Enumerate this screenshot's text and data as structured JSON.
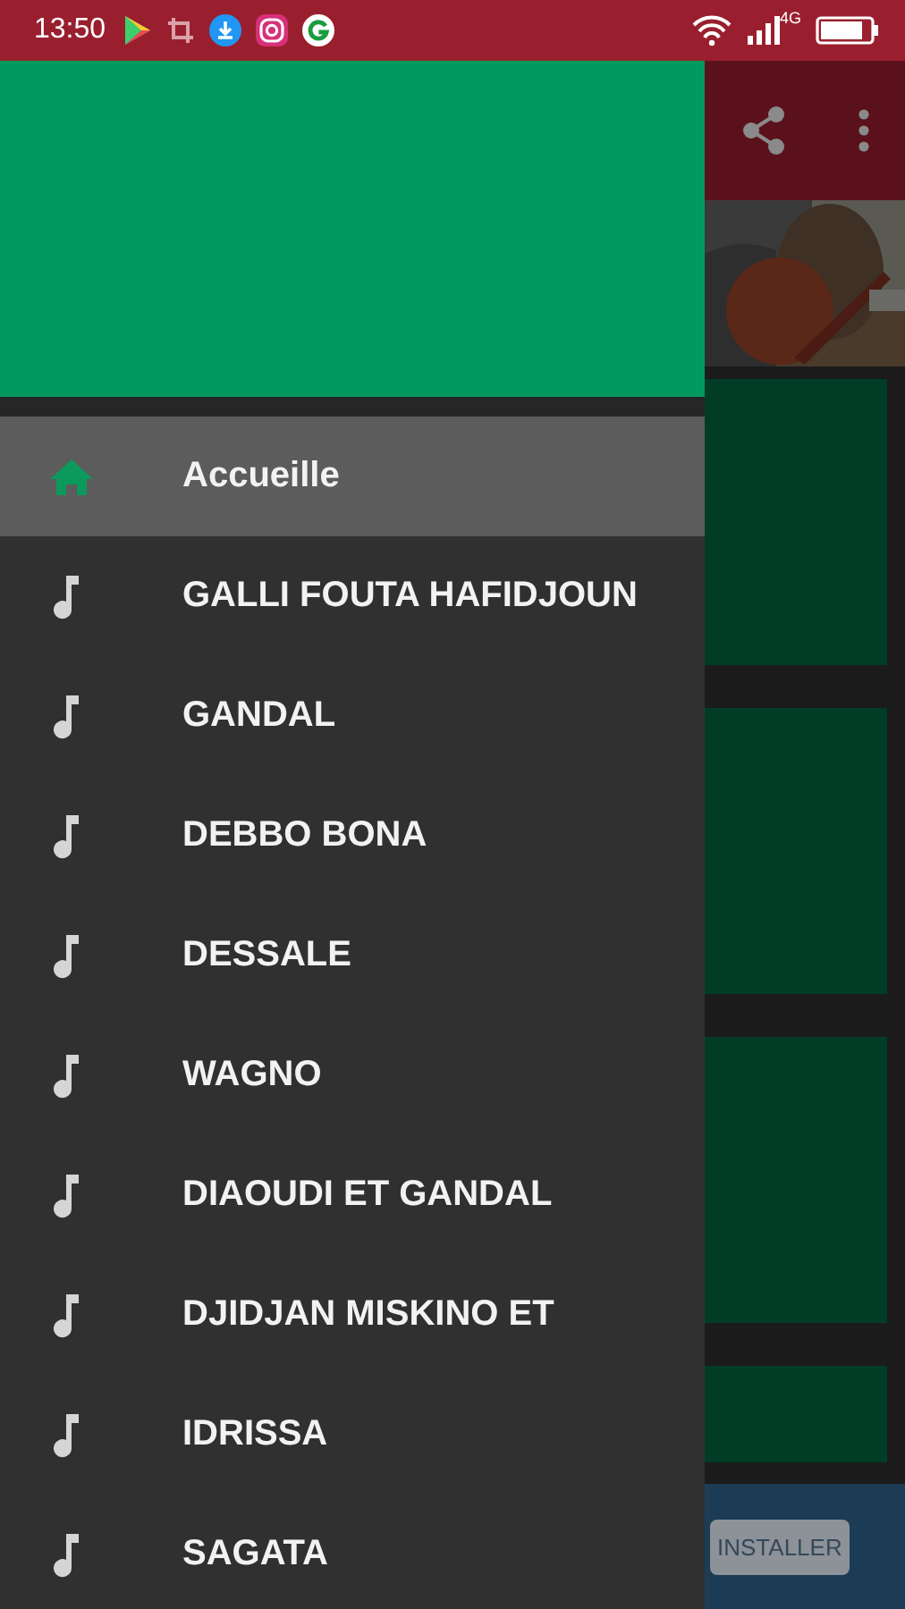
{
  "status_bar": {
    "time": "13:50",
    "network": "4G"
  },
  "drawer": {
    "items": [
      {
        "label": "Accueille",
        "kind": "home",
        "selected": true
      },
      {
        "label": "GALLI FOUTA HAFIDJOUN",
        "kind": "song",
        "selected": false
      },
      {
        "label": "GANDAL",
        "kind": "song",
        "selected": false
      },
      {
        "label": "DEBBO BONA",
        "kind": "song",
        "selected": false
      },
      {
        "label": "DESSALE",
        "kind": "song",
        "selected": false
      },
      {
        "label": "WAGNO",
        "kind": "song",
        "selected": false
      },
      {
        "label": "DIAOUDI ET GANDAL",
        "kind": "song",
        "selected": false
      },
      {
        "label": "DJIDJAN MISKINO ET",
        "kind": "song",
        "selected": false
      },
      {
        "label": "IDRISSA",
        "kind": "song",
        "selected": false
      },
      {
        "label": "SAGATA",
        "kind": "song",
        "selected": false
      }
    ]
  },
  "background_app": {
    "ad_banner": {
      "button": "INSTALLER"
    }
  }
}
